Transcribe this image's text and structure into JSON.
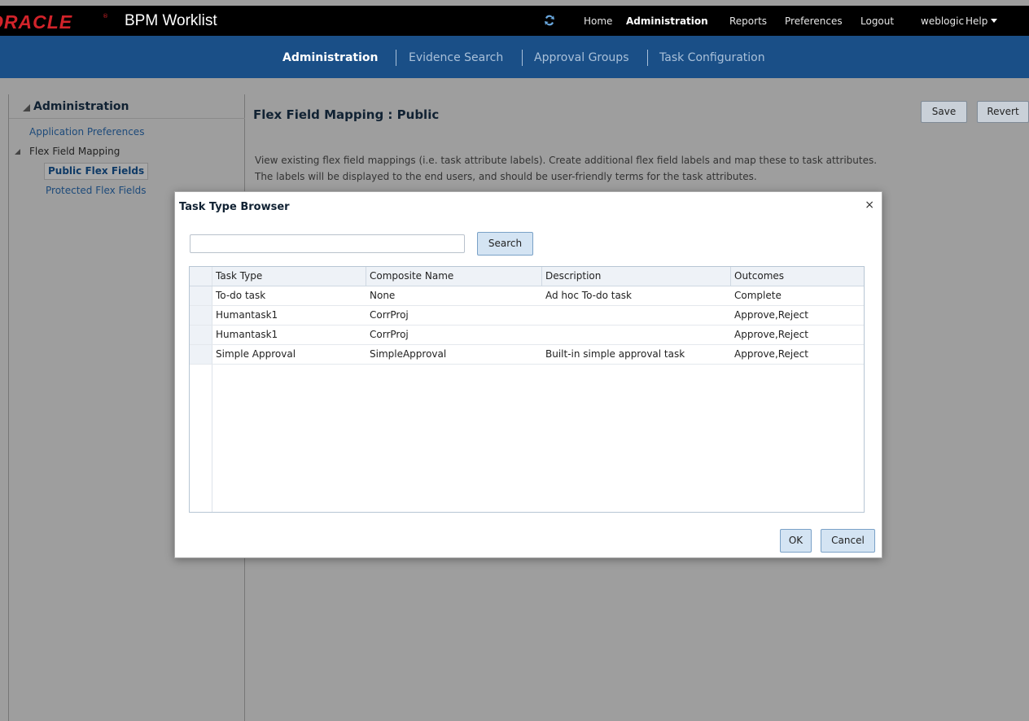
{
  "header": {
    "brand": "ORACLE",
    "app_title": "BPM Worklist",
    "nav": {
      "home": "Home",
      "administration": "Administration",
      "reports": "Reports",
      "preferences": "Preferences",
      "logout": "Logout",
      "user": "weblogic",
      "help": "Help"
    }
  },
  "subnav": {
    "items": [
      "Administration",
      "Evidence Search",
      "Approval Groups",
      "Task Configuration"
    ],
    "active": "Administration"
  },
  "sidebar": {
    "title": "Administration",
    "items": [
      {
        "label": "Application Preferences"
      },
      {
        "label": "Flex Field Mapping"
      },
      {
        "label": "Public Flex Fields"
      },
      {
        "label": "Protected Flex Fields"
      }
    ]
  },
  "main": {
    "title": "Flex Field Mapping : Public",
    "save_label": "Save",
    "revert_label": "Revert",
    "description_line1": "View existing flex field mappings (i.e. task attribute labels). Create additional flex field labels and map these to task attributes.",
    "description_line2": "The labels will be displayed to the end users, and should be user-friendly terms for the task attributes."
  },
  "dialog": {
    "title": "Task Type Browser",
    "search_value": "",
    "search_button": "Search",
    "columns": [
      "Task Type",
      "Composite Name",
      "Description",
      "Outcomes"
    ],
    "rows": [
      [
        "To-do task",
        "None",
        "Ad hoc To-do task",
        "Complete"
      ],
      [
        "Humantask1",
        "CorrProj",
        "",
        "Approve,Reject"
      ],
      [
        "Humantask1",
        "CorrProj",
        "",
        "Approve,Reject"
      ],
      [
        "Simple Approval",
        "SimpleApproval",
        "Built-in simple approval task",
        "Approve,Reject"
      ]
    ],
    "ok_label": "OK",
    "cancel_label": "Cancel"
  },
  "colors": {
    "topbar": "#000000",
    "subnav": "#1a4f87",
    "brand_red": "#d2232a",
    "overlay": "#9e9e9e"
  }
}
